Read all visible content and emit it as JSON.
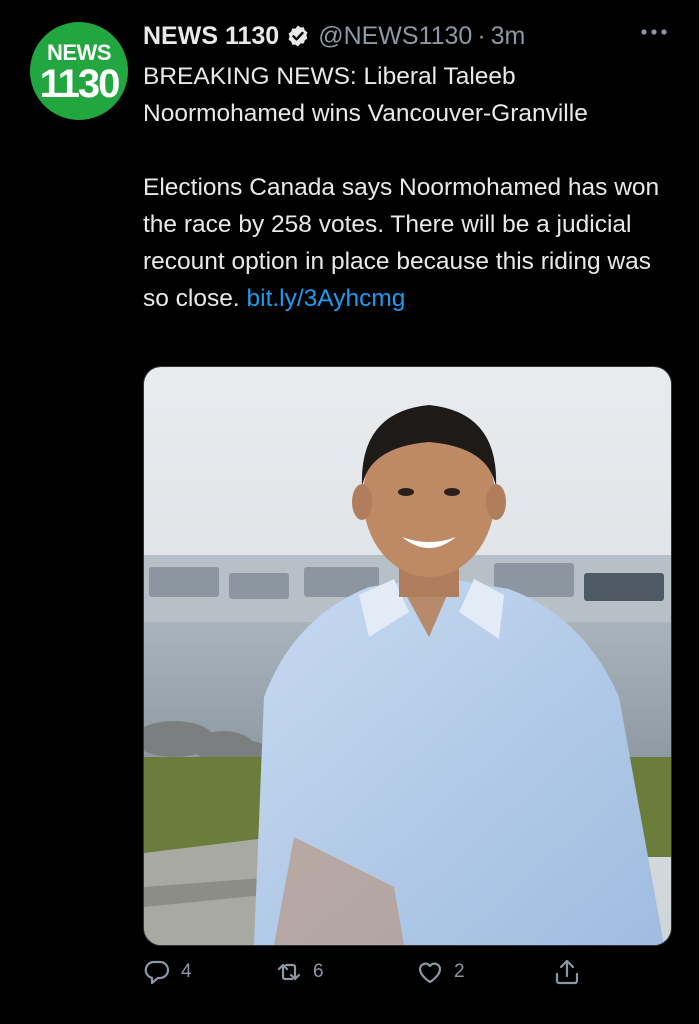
{
  "account": {
    "avatar_text_top": "NEWS",
    "avatar_text_bottom": "1130",
    "avatar_color": "#21a640",
    "name": "NEWS 1130",
    "verified_icon": "verified-badge-icon",
    "handle": "@NEWS1130",
    "separator": "·",
    "time": "3m"
  },
  "tweet": {
    "headline": "BREAKING NEWS: Liberal Taleeb Noormohamed wins Vancouver-Granville",
    "body": "Elections Canada says Noormohamed has won the race by 258 votes. There will be a judicial recount option in place because this riding was so close.",
    "link_text": "bit.ly/3Ayhcmg",
    "link_color": "#1d9bf0"
  },
  "media": {
    "description_icon": "photo-of-smiling-man-by-harbour"
  },
  "actions": {
    "reply_count": "4",
    "retweet_count": "6",
    "like_count": "2",
    "reply_icon": "reply-icon",
    "retweet_icon": "retweet-icon",
    "like_icon": "heart-icon",
    "share_icon": "share-icon"
  },
  "colors": {
    "background": "#000000",
    "primary_text": "#e7e9ea",
    "secondary_text": "#8b98a5"
  }
}
